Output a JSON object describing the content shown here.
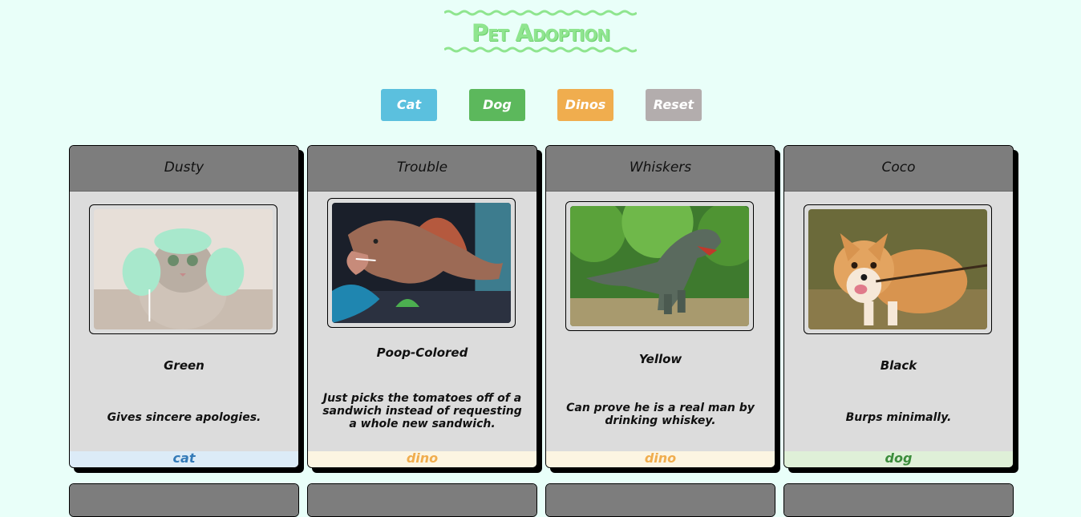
{
  "header": {
    "title": "Pet Adoption",
    "title_color": "#8fe58f"
  },
  "filters": {
    "cat_label": "Cat",
    "dog_label": "Dog",
    "dino_label": "Dinos",
    "reset_label": "Reset",
    "cat_color": "#5bc0de",
    "dog_color": "#5cb85c",
    "dino_color": "#f0ad4e",
    "reset_color": "#b3adad"
  },
  "pets": [
    {
      "name": "Dusty",
      "color": "Green",
      "special_skill": "Gives sincere apologies.",
      "type": "cat",
      "image_icon": "cat-photo"
    },
    {
      "name": "Trouble",
      "color": "Poop-Colored",
      "special_skill": "Just picks the tomatoes off of a sandwich instead of requesting a whole new sandwich.",
      "type": "dino",
      "image_icon": "dino-photo"
    },
    {
      "name": "Whiskers",
      "color": "Yellow",
      "special_skill": "Can prove he is a real man by drinking whiskey.",
      "type": "dino",
      "image_icon": "dino-photo"
    },
    {
      "name": "Coco",
      "color": "Black",
      "special_skill": "Burps minimally.",
      "type": "dog",
      "image_icon": "dog-photo"
    }
  ]
}
